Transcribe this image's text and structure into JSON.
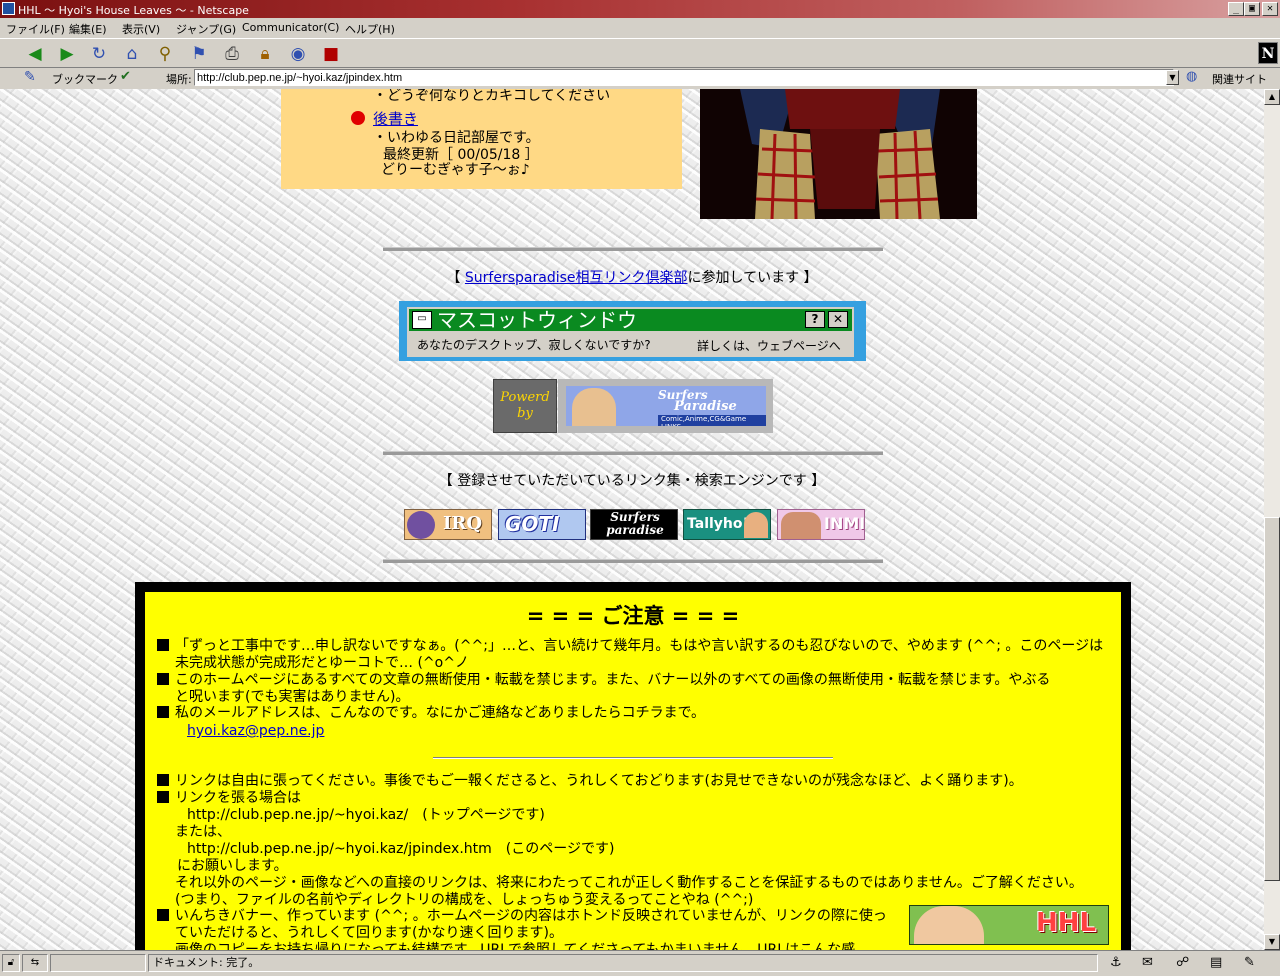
{
  "window": {
    "title": "HHL 〜 Hyoi's House Leaves 〜 - Netscape",
    "controls": [
      "_",
      "▣",
      "✕"
    ]
  },
  "menubar": [
    "ファイル(F)",
    "編集(E)",
    "表示(V)",
    "ジャンプ(G)",
    "Communicator(C)",
    "ヘルプ(H)"
  ],
  "toolbar": {
    "icons": [
      "back-icon",
      "forward-icon",
      "reload-icon",
      "home-icon",
      "search-icon",
      "guide-icon",
      "print-icon",
      "security-icon",
      "shop-icon",
      "stop-icon"
    ],
    "logo": "N"
  },
  "location_bar": {
    "bookmarks_label": "ブックマーク",
    "location_label": "場所:",
    "url": "http://club.pep.ne.jp/~hyoi.kaz/jpindex.htm",
    "related_label": "関連サイト"
  },
  "page": {
    "menu_items": {
      "partial_text": "・どうぞ何なりとカキコしてください",
      "afterword_link": "後書き",
      "afterword_desc": "・いわゆる日記部屋です。",
      "last_updated": "最終更新［ 00/05/18 ］",
      "catchphrase": "どりーむぎゃす子〜ぉ♪"
    },
    "club_line": {
      "prefix": "【 ",
      "link": "Surfersparadise相互リンク倶楽部",
      "suffix": "に参加しています 】"
    },
    "mascot_banner": {
      "title": "マスコットウィンドウ",
      "help_btn": "?",
      "close_btn": "✕",
      "left_text": "あなたのデスクトップ、寂しくないですか?",
      "right_text": "詳しくは、ウェブページへ"
    },
    "powered": {
      "line1": "Powerd",
      "line2": "by",
      "banner_title_1": "Surfers",
      "banner_title_2": "Paradise",
      "banner_sub": "Comic,Anime,CG&Game LINKS"
    },
    "registered_line": "【 登録させていただいているリンク集・検索エンジンです 】",
    "link_banners": [
      "IRQ",
      "GOTI",
      "Surfers paradise",
      "Tallyho!",
      "INMI"
    ],
    "notice": {
      "title": "= = =  ご注意  = = =",
      "lines": [
        "「ずっと工事中です…申し訳ないですなぁ。(^^;」…と、言い続けて幾年月。もはや言い訳するのも忍びないので、やめます (^^; 。このページは",
        "未完成状態が完成形だとゆーコトで… (^o^ノ",
        "このホームページにあるすべての文章の無断使用・転載を禁じます。また、バナー以外のすべての画像の無断使用・転載を禁じます。やぶる",
        "と呪います(でも実害はありません)。",
        "私のメールアドレスは、こんなのです。なにかご連絡などありましたらコチラまで。",
        "hyoi.kaz@pep.ne.jp",
        "リンクは自由に張ってください。事後でもご一報くださると、うれしくておどります(お見せできないのが残念なほど、よく踊ります)。",
        "リンクを張る場合は",
        "http://club.pep.ne.jp/~hyoi.kaz/　(トップページです)",
        "または、",
        "http://club.pep.ne.jp/~hyoi.kaz/jpindex.htm　(このページです)",
        "にお願いします。",
        "それ以外のページ・画像などへの直接のリンクは、将来にわたってこれが正しく動作することを保証するものではありません。ご了解ください。",
        "(つまり、ファイルの名前やディレクトリの構成を、しょっちゅう変えるってことやね (^^;)",
        "いんちきバナー、作っています (^^; 。ホームページの内容はホトンド反映されていませんが、リンクの際に使っ",
        "ていただけると、うれしくて回ります(かなり速く回ります)。",
        "画像のコピーをお持ち帰りになっても結構です。URLで参照してくださってもかまいません。URLはこんな感"
      ],
      "banner_text": "HHL"
    }
  },
  "statusbar": {
    "text": "ドキュメント: 完了。"
  },
  "colors": {
    "menu_box": "#ffd985",
    "notice_bg": "#ffff00",
    "notice_border": "#000000",
    "link": "#0000cc",
    "bullet": "#e00000"
  }
}
